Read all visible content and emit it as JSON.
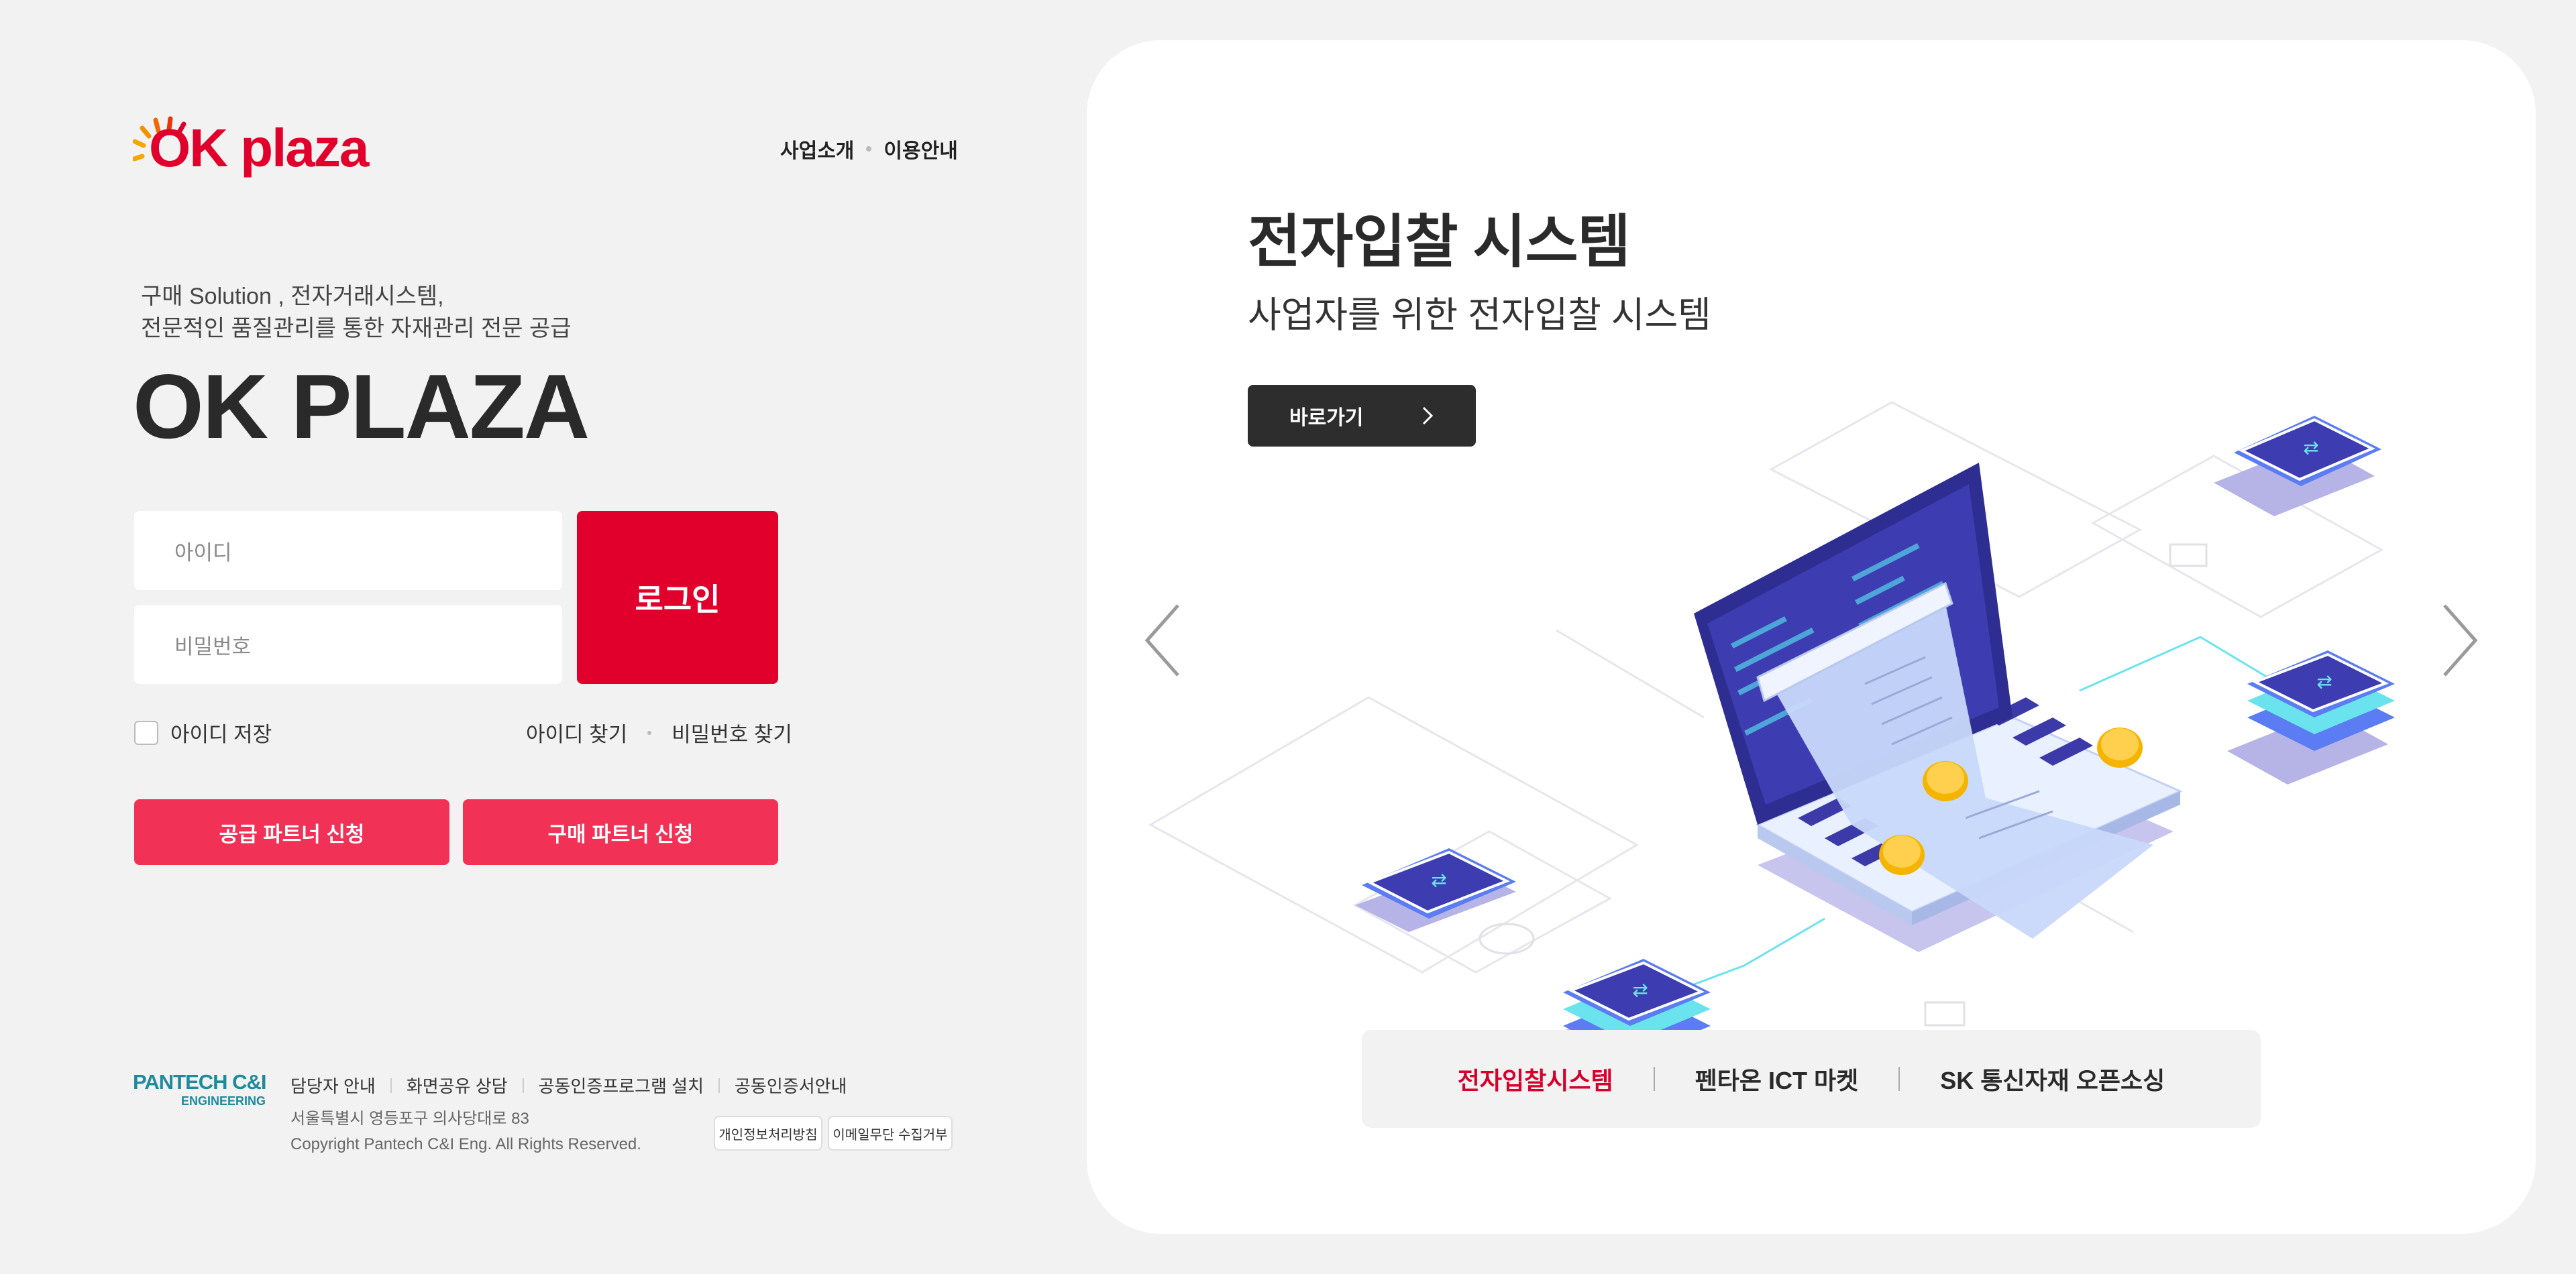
{
  "brand": {
    "logo_text": "OK plaza"
  },
  "nav": {
    "items": [
      "사업소개",
      "이용안내"
    ]
  },
  "hero": {
    "tagline_line1": "구매 Solution , 전자거래시스템,",
    "tagline_line2": "전문적인 품질관리를 통한 자재관리 전문 공급",
    "title": "OK PLAZA"
  },
  "login": {
    "id_placeholder": "아이디",
    "password_placeholder": "비밀번호",
    "login_label": "로그인",
    "save_id_label": "아이디 저장",
    "save_id_checked": false,
    "find_id_label": "아이디 찾기",
    "find_password_label": "비밀번호 찾기",
    "supply_partner_label": "공급 파트너 신청",
    "purchase_partner_label": "구매 파트너 신청"
  },
  "footer": {
    "company_logo_line1": "PANTECH C&I",
    "company_logo_line2": "ENGINEERING",
    "links": [
      "담당자 안내",
      "화면공유 상담",
      "공동인증프로그램 설치",
      "공동인증서안내"
    ],
    "address": "서울특별시 영등포구 의사당대로 83",
    "copyright": "Copyright Pantech C&I Eng. All Rights Reserved.",
    "privacy_label": "개인정보처리방침",
    "email_refusal_label": "이메일무단 수집거부"
  },
  "slide": {
    "title": "전자입찰 시스템",
    "subtitle": "사업자를 위한 전자입찰 시스템",
    "go_label": "바로가기"
  },
  "tabs": [
    {
      "label": "전자입찰시스템",
      "active": true
    },
    {
      "label": "펜타온 ICT 마켓",
      "active": false
    },
    {
      "label": "SK 통신자재 오픈소싱",
      "active": false
    }
  ],
  "icons": [
    "sunburst-icon",
    "chevron-right-icon",
    "arrow-left-icon",
    "arrow-right-icon"
  ],
  "colors": {
    "brand_red": "#e0002b",
    "partner_pink": "#f13156",
    "active_tab": "#d6002b",
    "dark_button": "#2d2d2d",
    "pantech_teal": "#1e8a9c"
  }
}
